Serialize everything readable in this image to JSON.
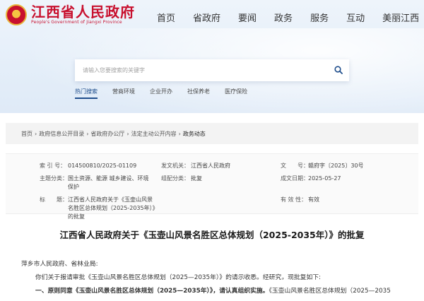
{
  "site": {
    "name": "江西省人民政府",
    "name_en": "People's Government of Jiangxi Province"
  },
  "nav": [
    "首页",
    "省政府",
    "要闻",
    "政务",
    "服务",
    "互动",
    "美丽江西"
  ],
  "search": {
    "placeholder": "请输入您要搜索的关键字"
  },
  "quick_links": [
    "热门搜索",
    "营商环境",
    "企业开办",
    "社保养老",
    "医疗保险"
  ],
  "breadcrumb": [
    "首页",
    "政府信息公开目录",
    "省政府办公厅",
    "法定主动公开内容",
    "政务动态"
  ],
  "meta": {
    "index_label": "索 引 号：",
    "index_value": "014500810/2025-01109",
    "issuer_label": "发文机关：",
    "issuer_value": "江西省人民政府",
    "docno_label": "文　　号：",
    "docno_value": "赣府字〔2025〕30号",
    "topic_label": "主题分类：",
    "topic_value": "国土资源、能源 城乡建设、环境保护",
    "form_label": "组配分类：",
    "form_value": "批复",
    "date_label": "成文日期：",
    "date_value": "2025-05-27",
    "title_label": "标　　题：",
    "title_value": "江西省人民政府关于《玉壶山风景名胜区总体规划（2025-2035年）》的批复",
    "valid_label": "有 效 性：",
    "valid_value": "有效"
  },
  "document": {
    "title": "江西省人民政府关于《玉壶山风景名胜区总体规划（2025-2035年）》的批复",
    "addressee": "萍乡市人民政府、省林业局:",
    "para1": "你们关于报请审批《玉壶山风景名胜区总体规划（2025—2035年）》的请示收悉。经研究，现批复如下:",
    "para2_bold": "一、原则同意《玉壶山风景名胜区总体规划（2025—2035年）》，请认真组织实施。",
    "para2_rest": "《玉壶山风景名胜区总体规划（2025—2035"
  },
  "colors": {
    "brand_red": "#c8102e",
    "link_blue": "#1f4e8c"
  }
}
